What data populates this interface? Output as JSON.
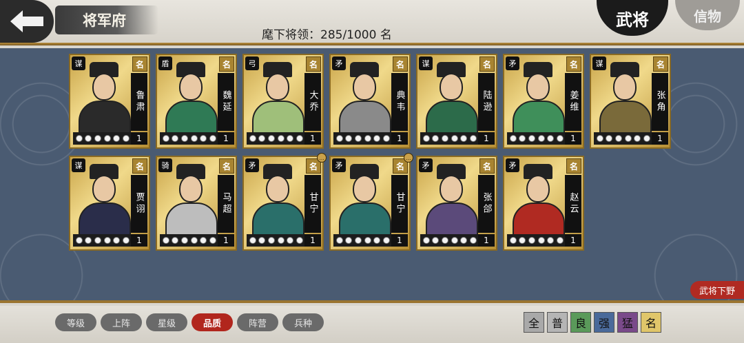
{
  "header": {
    "title": "将军府",
    "count_label": "麾下将领：285/1000 名",
    "tab_generals": "武将",
    "tab_tokens": "信物"
  },
  "cards": [
    {
      "type": "谋",
      "grade": "名",
      "name": "鲁肃",
      "level": "1",
      "color": "#2a2a2a",
      "extra": ""
    },
    {
      "type": "盾",
      "grade": "名",
      "name": "魏延",
      "level": "1",
      "color": "#2f7a55",
      "extra": ""
    },
    {
      "type": "弓",
      "grade": "名",
      "name": "大乔",
      "level": "1",
      "color": "#9fbf7a",
      "extra": ""
    },
    {
      "type": "矛",
      "grade": "名",
      "name": "典韦",
      "level": "1",
      "color": "#8a8a8a",
      "extra": ""
    },
    {
      "type": "谋",
      "grade": "名",
      "name": "陆逊",
      "level": "1",
      "color": "#2c6b4a",
      "extra": ""
    },
    {
      "type": "矛",
      "grade": "名",
      "name": "姜维",
      "level": "1",
      "color": "#3f8f5a",
      "extra": ""
    },
    {
      "type": "谋",
      "grade": "名",
      "name": "张角",
      "level": "1",
      "color": "#7a6a3a",
      "extra": ""
    },
    {
      "type": "谋",
      "grade": "名",
      "name": "贾诩",
      "level": "1",
      "color": "#2a2d4a",
      "extra": ""
    },
    {
      "type": "骑",
      "grade": "名",
      "name": "马超",
      "level": "1",
      "color": "#bdbdbd",
      "extra": ""
    },
    {
      "type": "矛",
      "grade": "名",
      "name": "甘宁",
      "level": "1",
      "color": "#2a6f6a",
      "extra": "..."
    },
    {
      "type": "矛",
      "grade": "名",
      "name": "甘宁",
      "level": "1",
      "color": "#2a6f6a",
      "extra": "..."
    },
    {
      "type": "矛",
      "grade": "名",
      "name": "张郃",
      "level": "1",
      "color": "#5b4a7a",
      "extra": ""
    },
    {
      "type": "矛",
      "grade": "名",
      "name": "赵云",
      "level": "1",
      "color": "#b02a22",
      "extra": ""
    }
  ],
  "stars_per_card": 6,
  "dismiss_label": "武将下野",
  "sort_buttons": [
    {
      "label": "等级",
      "active": false
    },
    {
      "label": "上阵",
      "active": false
    },
    {
      "label": "星级",
      "active": false
    },
    {
      "label": "品质",
      "active": true
    },
    {
      "label": "阵营",
      "active": false
    },
    {
      "label": "兵种",
      "active": false
    }
  ],
  "quality_filters": [
    {
      "label": "全",
      "color": "#a9a9a9"
    },
    {
      "label": "普",
      "color": "#b5b5b5"
    },
    {
      "label": "良",
      "color": "#5a9a5a"
    },
    {
      "label": "强",
      "color": "#4a6a9a"
    },
    {
      "label": "猛",
      "color": "#7a4a8a"
    },
    {
      "label": "名",
      "color": "#e0c66a"
    }
  ],
  "colors": {
    "panel": "#4a5b72",
    "accent_red": "#b1261d",
    "gold": "#c9a449"
  }
}
